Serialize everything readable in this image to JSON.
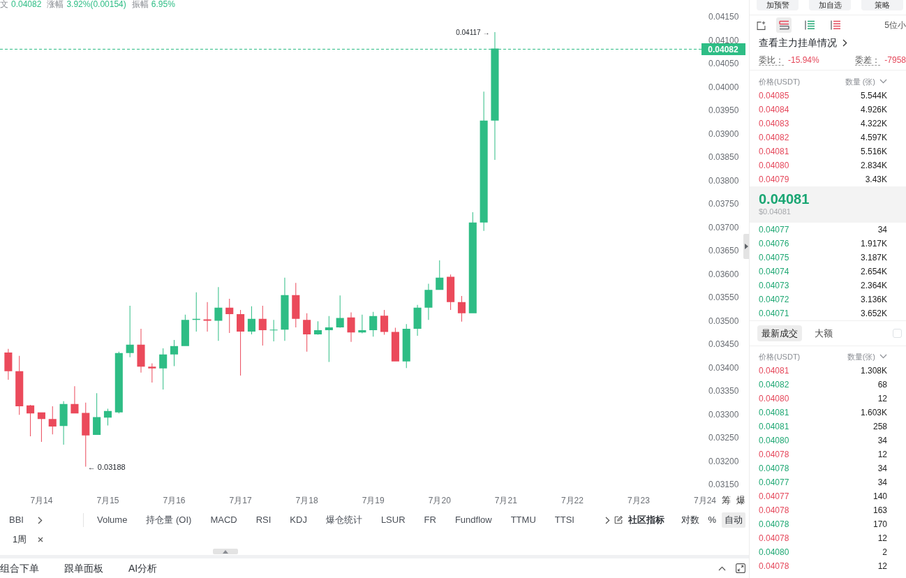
{
  "header": {
    "stats": [
      {
        "label": "文",
        "value": "0.04082"
      },
      {
        "label": "涨幅",
        "value": "3.92%(0.00154)"
      },
      {
        "label": "振幅",
        "value": "6.95%"
      }
    ]
  },
  "chart": {
    "chart_data": [
      {
        "type": "candlestick",
        "x": [
          "--07-13T12:00",
          "--07-13T16:00",
          "--07-13T20:00",
          "--07-14T00:00",
          "--07-14T04:00",
          "--07-14T08:00",
          "--07-14T12:00",
          "--07-14T16:00",
          "--07-14T20:00",
          "--07-15T00:00",
          "--07-15T04:00",
          "--07-15T08:00",
          "--07-15T12:00",
          "--07-15T16:00",
          "--07-15T20:00",
          "--07-16T00:00",
          "--07-16T04:00",
          "--07-16T08:00",
          "--07-16T12:00",
          "--07-16T16:00",
          "--07-16T20:00",
          "--07-17T00:00",
          "--07-17T04:00",
          "--07-17T08:00",
          "--07-17T12:00",
          "--07-17T16:00",
          "--07-17T20:00",
          "--07-18T00:00",
          "--07-18T04:00",
          "--07-18T08:00",
          "--07-18T12:00",
          "--07-18T16:00",
          "--07-18T20:00",
          "--07-19T00:00",
          "--07-19T04:00",
          "--07-19T08:00",
          "--07-19T12:00",
          "--07-19T16:00",
          "--07-19T20:00",
          "--07-20T00:00",
          "--07-20T04:00",
          "--07-20T08:00",
          "--07-20T12:00",
          "--07-20T16:00",
          "--07-20T20:00"
        ],
        "ohlc": [
          [
            0.03432,
            0.0344,
            0.03374,
            0.03392
          ],
          [
            0.03392,
            0.03425,
            0.03299,
            0.03317
          ],
          [
            0.03319,
            0.0332,
            0.03253,
            0.03302
          ],
          [
            0.03304,
            0.03304,
            0.03241,
            0.0329
          ],
          [
            0.0329,
            0.03317,
            0.03257,
            0.03274
          ],
          [
            0.03275,
            0.03328,
            0.03235,
            0.03322
          ],
          [
            0.03322,
            0.0336,
            0.03302,
            0.03302
          ],
          [
            0.03303,
            0.03325,
            0.03188,
            0.03255
          ],
          [
            0.03256,
            0.03345,
            0.03256,
            0.03294
          ],
          [
            0.03293,
            0.03312,
            0.03276,
            0.03307
          ],
          [
            0.03304,
            0.03434,
            0.03302,
            0.03431
          ],
          [
            0.03431,
            0.03532,
            0.03422,
            0.03449
          ],
          [
            0.03449,
            0.03483,
            0.03389,
            0.03402
          ],
          [
            0.03402,
            0.03409,
            0.03368,
            0.03398
          ],
          [
            0.03398,
            0.03441,
            0.03353,
            0.03428
          ],
          [
            0.03428,
            0.03459,
            0.03403,
            0.03446
          ],
          [
            0.03446,
            0.03513,
            0.03446,
            0.03502
          ],
          [
            0.03502,
            0.03561,
            0.03477,
            0.03504
          ],
          [
            0.03503,
            0.0354,
            0.03477,
            0.035
          ],
          [
            0.035,
            0.03572,
            0.03457,
            0.03528
          ],
          [
            0.03528,
            0.03547,
            0.03474,
            0.03514
          ],
          [
            0.03514,
            0.03523,
            0.03383,
            0.03477
          ],
          [
            0.03477,
            0.03531,
            0.03471,
            0.03504
          ],
          [
            0.03504,
            0.03532,
            0.03447,
            0.0348
          ],
          [
            0.0348,
            0.03502,
            0.03456,
            0.03481
          ],
          [
            0.03481,
            0.03592,
            0.03457,
            0.03555
          ],
          [
            0.03555,
            0.03581,
            0.03486,
            0.03504
          ],
          [
            0.03502,
            0.03516,
            0.03434,
            0.03471
          ],
          [
            0.03471,
            0.03499,
            0.0347,
            0.0348
          ],
          [
            0.0348,
            0.0351,
            0.03412,
            0.03486
          ],
          [
            0.03486,
            0.03554,
            0.03485,
            0.03506
          ],
          [
            0.03507,
            0.03518,
            0.03455,
            0.03475
          ],
          [
            0.03475,
            0.03513,
            0.03473,
            0.0348
          ],
          [
            0.0348,
            0.03519,
            0.03466,
            0.0351
          ],
          [
            0.03511,
            0.03523,
            0.0347,
            0.03476
          ],
          [
            0.03476,
            0.03485,
            0.03413,
            0.03413
          ],
          [
            0.03413,
            0.03493,
            0.03399,
            0.03483
          ],
          [
            0.03483,
            0.03534,
            0.03468,
            0.03528
          ],
          [
            0.03528,
            0.03579,
            0.03502,
            0.03566
          ],
          [
            0.03566,
            0.03629,
            0.03566,
            0.03592
          ],
          [
            0.03594,
            0.03599,
            0.03523,
            0.0354
          ],
          [
            0.0354,
            0.03553,
            0.03498,
            0.03516
          ],
          [
            0.03516,
            0.03732,
            0.03516,
            0.0371
          ],
          [
            0.0371,
            0.0399,
            0.03692,
            0.03928
          ],
          [
            0.03928,
            0.04117,
            0.03844,
            0.04082
          ]
        ],
        "xlim": [
          "--07-13T09:00",
          "--07-24T00:00"
        ],
        "ylim": [
          0.0315,
          0.0415
        ],
        "xticks": [
          {
            "value": "--07-14",
            "label": "7月14"
          },
          {
            "value": "--07-15",
            "label": "7月15"
          },
          {
            "value": "--07-16",
            "label": "7月16"
          },
          {
            "value": "--07-17",
            "label": "7月17"
          },
          {
            "value": "--07-18",
            "label": "7月18"
          },
          {
            "value": "--07-19",
            "label": "7月19"
          },
          {
            "value": "--07-20",
            "label": "7月20"
          },
          {
            "value": "--07-21",
            "label": "7月21"
          },
          {
            "value": "--07-22",
            "label": "7月22"
          },
          {
            "value": "--07-23",
            "label": "7月23"
          },
          {
            "value": "--07-24",
            "label": "7月24"
          }
        ],
        "yticks": [
          {
            "value": 0.0415,
            "label": "0.04150"
          },
          {
            "value": 0.041,
            "label": "0.04100"
          },
          {
            "value": 0.0405,
            "label": "0.04050"
          },
          {
            "value": 0.04,
            "label": "0.04000"
          },
          {
            "value": 0.0395,
            "label": "0.03950"
          },
          {
            "value": 0.039,
            "label": "0.03900"
          },
          {
            "value": 0.0385,
            "label": "0.03850"
          },
          {
            "value": 0.038,
            "label": "0.03800"
          },
          {
            "value": 0.0375,
            "label": "0.03750"
          },
          {
            "value": 0.037,
            "label": "0.03700"
          },
          {
            "value": 0.0365,
            "label": "0.03650"
          },
          {
            "value": 0.036,
            "label": "0.03600"
          },
          {
            "value": 0.0355,
            "label": "0.03550"
          },
          {
            "value": 0.035,
            "label": "0.03500"
          },
          {
            "value": 0.0345,
            "label": "0.03450"
          },
          {
            "value": 0.034,
            "label": "0.03400"
          },
          {
            "value": 0.0335,
            "label": "0.03350"
          },
          {
            "value": 0.033,
            "label": "0.03300"
          },
          {
            "value": 0.0325,
            "label": "0.03250"
          },
          {
            "value": 0.032,
            "label": "0.03200"
          },
          {
            "value": 0.0315,
            "label": "0.03150"
          }
        ],
        "ref_lines": [
          {
            "axis": "y",
            "value": 0.04082,
            "label": "0.04082",
            "color": "#2ebd85",
            "line_style": "dashed"
          }
        ],
        "annotations": [
          "0.04117 →",
          "← 0.03188"
        ]
      }
    ],
    "side_buttons": [
      "筹",
      "爆"
    ]
  },
  "indicator_bar": {
    "main": [
      {
        "label": "BBI"
      }
    ],
    "sub": [
      {
        "label": "Volume"
      },
      {
        "label": "持仓量 (OI)"
      },
      {
        "label": "MACD"
      },
      {
        "label": "RSI"
      },
      {
        "label": "KDJ"
      },
      {
        "label": "爆仓统计"
      },
      {
        "label": "LSUR"
      },
      {
        "label": "FR"
      },
      {
        "label": "Fundflow"
      },
      {
        "label": "TTMU"
      },
      {
        "label": "TTSI"
      }
    ],
    "community": "社区指标",
    "scale_options": [
      {
        "label": "对数",
        "selected": false
      },
      {
        "label": "%",
        "selected": false
      },
      {
        "label": "自动",
        "selected": true
      }
    ]
  },
  "active_periods": [
    "1周"
  ],
  "bottom_tabs": [
    "组合下单",
    "跟单面板",
    "AI分析"
  ],
  "side_panel": {
    "actions": [
      "加预警",
      "加自选",
      "策略"
    ],
    "book_views": [
      {
        "kind": "both",
        "selected": true
      },
      {
        "kind": "bids",
        "selected": false
      },
      {
        "kind": "asks",
        "selected": false
      }
    ],
    "precision": "5位小",
    "depth_link": "查看主力挂单情况",
    "stats": [
      {
        "label": "委比：",
        "value": "-15.94%"
      },
      {
        "label": "委差：",
        "value": "-7958"
      }
    ],
    "order_book": {
      "columns": [
        "价格(USDT)",
        "数量 (张)"
      ],
      "asks": [
        {
          "price": "0.04085",
          "amount": "5.544K"
        },
        {
          "price": "0.04084",
          "amount": "4.926K"
        },
        {
          "price": "0.04083",
          "amount": "4.322K"
        },
        {
          "price": "0.04082",
          "amount": "4.597K"
        },
        {
          "price": "0.04081",
          "amount": "5.516K"
        },
        {
          "price": "0.04080",
          "amount": "2.834K"
        },
        {
          "price": "0.04079",
          "amount": "3.43K"
        }
      ],
      "last_price": "0.04081",
      "last_price_usd": "$0.04081",
      "bids": [
        {
          "price": "0.04077",
          "amount": "34"
        },
        {
          "price": "0.04076",
          "amount": "1.917K"
        },
        {
          "price": "0.04075",
          "amount": "3.187K"
        },
        {
          "price": "0.04074",
          "amount": "2.654K"
        },
        {
          "price": "0.04073",
          "amount": "2.364K"
        },
        {
          "price": "0.04072",
          "amount": "3.136K"
        },
        {
          "price": "0.04071",
          "amount": "3.652K"
        }
      ]
    },
    "trades": {
      "tabs": [
        {
          "label": "最新成交",
          "selected": true
        },
        {
          "label": "大额",
          "selected": false
        }
      ],
      "filter_checked": false,
      "columns": [
        "价格(USDT)",
        "数量(张)"
      ],
      "rows": [
        {
          "price": "0.04081",
          "amount": "1.308K",
          "color": "#e5485b"
        },
        {
          "price": "0.04082",
          "amount": "68",
          "color": "#20a874"
        },
        {
          "price": "0.04080",
          "amount": "12",
          "color": "#e5485b"
        },
        {
          "price": "0.04081",
          "amount": "1.603K",
          "color": "#20a874"
        },
        {
          "price": "0.04081",
          "amount": "258",
          "color": "#20a874"
        },
        {
          "price": "0.04080",
          "amount": "34",
          "color": "#20a874"
        },
        {
          "price": "0.04078",
          "amount": "12",
          "color": "#e5485b"
        },
        {
          "price": "0.04078",
          "amount": "34",
          "color": "#20a874"
        },
        {
          "price": "0.04077",
          "amount": "34",
          "color": "#20a874"
        },
        {
          "price": "0.04077",
          "amount": "140",
          "color": "#e5485b"
        },
        {
          "price": "0.04078",
          "amount": "163",
          "color": "#e5485b"
        },
        {
          "price": "0.04078",
          "amount": "170",
          "color": "#20a874"
        },
        {
          "price": "0.04078",
          "amount": "12",
          "color": "#e5485b"
        },
        {
          "price": "0.04080",
          "amount": "2",
          "color": "#20a874"
        },
        {
          "price": "0.04078",
          "amount": "12",
          "color": "#e5485b"
        }
      ]
    }
  }
}
